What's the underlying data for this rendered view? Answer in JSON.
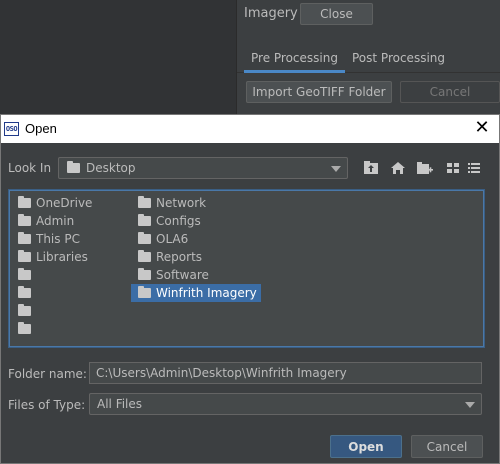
{
  "background_panel": {
    "title": "Imagery",
    "close_label": "Close",
    "tabs": [
      {
        "label": "Pre Processing",
        "active": true
      },
      {
        "label": "Post Processing",
        "active": false
      }
    ],
    "import_label": "Import GeoTIFF Folder",
    "cancel_label": "Cancel"
  },
  "dialog": {
    "app_icon_text": "OSO",
    "title": "Open",
    "close_glyph": "✕",
    "look_in_label": "Look In",
    "look_in_value": "Desktop",
    "toolbar_icons": [
      "up-folder-icon",
      "home-icon",
      "new-folder-icon",
      "list-view-icon",
      "details-view-icon"
    ],
    "files": {
      "col1": [
        "OneDrive",
        "Admin",
        "This PC",
        "Libraries",
        "",
        "",
        "",
        ""
      ],
      "col2": [
        "Network",
        "Configs",
        "OLA6",
        "Reports",
        "Software",
        "Winfrith Imagery"
      ]
    },
    "selected_item": "Winfrith Imagery",
    "folder_name_label": "Folder name:",
    "folder_name_value": "C:\\Users\\Admin\\Desktop\\Winfrith Imagery",
    "files_of_type_label": "Files of Type:",
    "files_of_type_value": "All Files",
    "open_label": "Open",
    "cancel_label": "Cancel"
  },
  "colors": {
    "dialog_bg": "#3c3f41",
    "selection": "#3b6da6",
    "accent": "#4a88c7"
  }
}
